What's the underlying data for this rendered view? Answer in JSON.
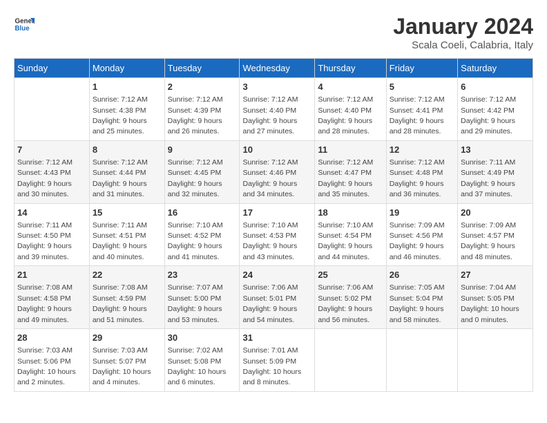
{
  "header": {
    "logo_general": "General",
    "logo_blue": "Blue",
    "title": "January 2024",
    "subtitle": "Scala Coeli, Calabria, Italy"
  },
  "calendar": {
    "days_of_week": [
      "Sunday",
      "Monday",
      "Tuesday",
      "Wednesday",
      "Thursday",
      "Friday",
      "Saturday"
    ],
    "weeks": [
      [
        {
          "day": "",
          "info": ""
        },
        {
          "day": "1",
          "info": "Sunrise: 7:12 AM\nSunset: 4:38 PM\nDaylight: 9 hours\nand 25 minutes."
        },
        {
          "day": "2",
          "info": "Sunrise: 7:12 AM\nSunset: 4:39 PM\nDaylight: 9 hours\nand 26 minutes."
        },
        {
          "day": "3",
          "info": "Sunrise: 7:12 AM\nSunset: 4:40 PM\nDaylight: 9 hours\nand 27 minutes."
        },
        {
          "day": "4",
          "info": "Sunrise: 7:12 AM\nSunset: 4:40 PM\nDaylight: 9 hours\nand 28 minutes."
        },
        {
          "day": "5",
          "info": "Sunrise: 7:12 AM\nSunset: 4:41 PM\nDaylight: 9 hours\nand 28 minutes."
        },
        {
          "day": "6",
          "info": "Sunrise: 7:12 AM\nSunset: 4:42 PM\nDaylight: 9 hours\nand 29 minutes."
        }
      ],
      [
        {
          "day": "7",
          "info": "Sunrise: 7:12 AM\nSunset: 4:43 PM\nDaylight: 9 hours\nand 30 minutes."
        },
        {
          "day": "8",
          "info": "Sunrise: 7:12 AM\nSunset: 4:44 PM\nDaylight: 9 hours\nand 31 minutes."
        },
        {
          "day": "9",
          "info": "Sunrise: 7:12 AM\nSunset: 4:45 PM\nDaylight: 9 hours\nand 32 minutes."
        },
        {
          "day": "10",
          "info": "Sunrise: 7:12 AM\nSunset: 4:46 PM\nDaylight: 9 hours\nand 34 minutes."
        },
        {
          "day": "11",
          "info": "Sunrise: 7:12 AM\nSunset: 4:47 PM\nDaylight: 9 hours\nand 35 minutes."
        },
        {
          "day": "12",
          "info": "Sunrise: 7:12 AM\nSunset: 4:48 PM\nDaylight: 9 hours\nand 36 minutes."
        },
        {
          "day": "13",
          "info": "Sunrise: 7:11 AM\nSunset: 4:49 PM\nDaylight: 9 hours\nand 37 minutes."
        }
      ],
      [
        {
          "day": "14",
          "info": "Sunrise: 7:11 AM\nSunset: 4:50 PM\nDaylight: 9 hours\nand 39 minutes."
        },
        {
          "day": "15",
          "info": "Sunrise: 7:11 AM\nSunset: 4:51 PM\nDaylight: 9 hours\nand 40 minutes."
        },
        {
          "day": "16",
          "info": "Sunrise: 7:10 AM\nSunset: 4:52 PM\nDaylight: 9 hours\nand 41 minutes."
        },
        {
          "day": "17",
          "info": "Sunrise: 7:10 AM\nSunset: 4:53 PM\nDaylight: 9 hours\nand 43 minutes."
        },
        {
          "day": "18",
          "info": "Sunrise: 7:10 AM\nSunset: 4:54 PM\nDaylight: 9 hours\nand 44 minutes."
        },
        {
          "day": "19",
          "info": "Sunrise: 7:09 AM\nSunset: 4:56 PM\nDaylight: 9 hours\nand 46 minutes."
        },
        {
          "day": "20",
          "info": "Sunrise: 7:09 AM\nSunset: 4:57 PM\nDaylight: 9 hours\nand 48 minutes."
        }
      ],
      [
        {
          "day": "21",
          "info": "Sunrise: 7:08 AM\nSunset: 4:58 PM\nDaylight: 9 hours\nand 49 minutes."
        },
        {
          "day": "22",
          "info": "Sunrise: 7:08 AM\nSunset: 4:59 PM\nDaylight: 9 hours\nand 51 minutes."
        },
        {
          "day": "23",
          "info": "Sunrise: 7:07 AM\nSunset: 5:00 PM\nDaylight: 9 hours\nand 53 minutes."
        },
        {
          "day": "24",
          "info": "Sunrise: 7:06 AM\nSunset: 5:01 PM\nDaylight: 9 hours\nand 54 minutes."
        },
        {
          "day": "25",
          "info": "Sunrise: 7:06 AM\nSunset: 5:02 PM\nDaylight: 9 hours\nand 56 minutes."
        },
        {
          "day": "26",
          "info": "Sunrise: 7:05 AM\nSunset: 5:04 PM\nDaylight: 9 hours\nand 58 minutes."
        },
        {
          "day": "27",
          "info": "Sunrise: 7:04 AM\nSunset: 5:05 PM\nDaylight: 10 hours\nand 0 minutes."
        }
      ],
      [
        {
          "day": "28",
          "info": "Sunrise: 7:03 AM\nSunset: 5:06 PM\nDaylight: 10 hours\nand 2 minutes."
        },
        {
          "day": "29",
          "info": "Sunrise: 7:03 AM\nSunset: 5:07 PM\nDaylight: 10 hours\nand 4 minutes."
        },
        {
          "day": "30",
          "info": "Sunrise: 7:02 AM\nSunset: 5:08 PM\nDaylight: 10 hours\nand 6 minutes."
        },
        {
          "day": "31",
          "info": "Sunrise: 7:01 AM\nSunset: 5:09 PM\nDaylight: 10 hours\nand 8 minutes."
        },
        {
          "day": "",
          "info": ""
        },
        {
          "day": "",
          "info": ""
        },
        {
          "day": "",
          "info": ""
        }
      ]
    ]
  }
}
